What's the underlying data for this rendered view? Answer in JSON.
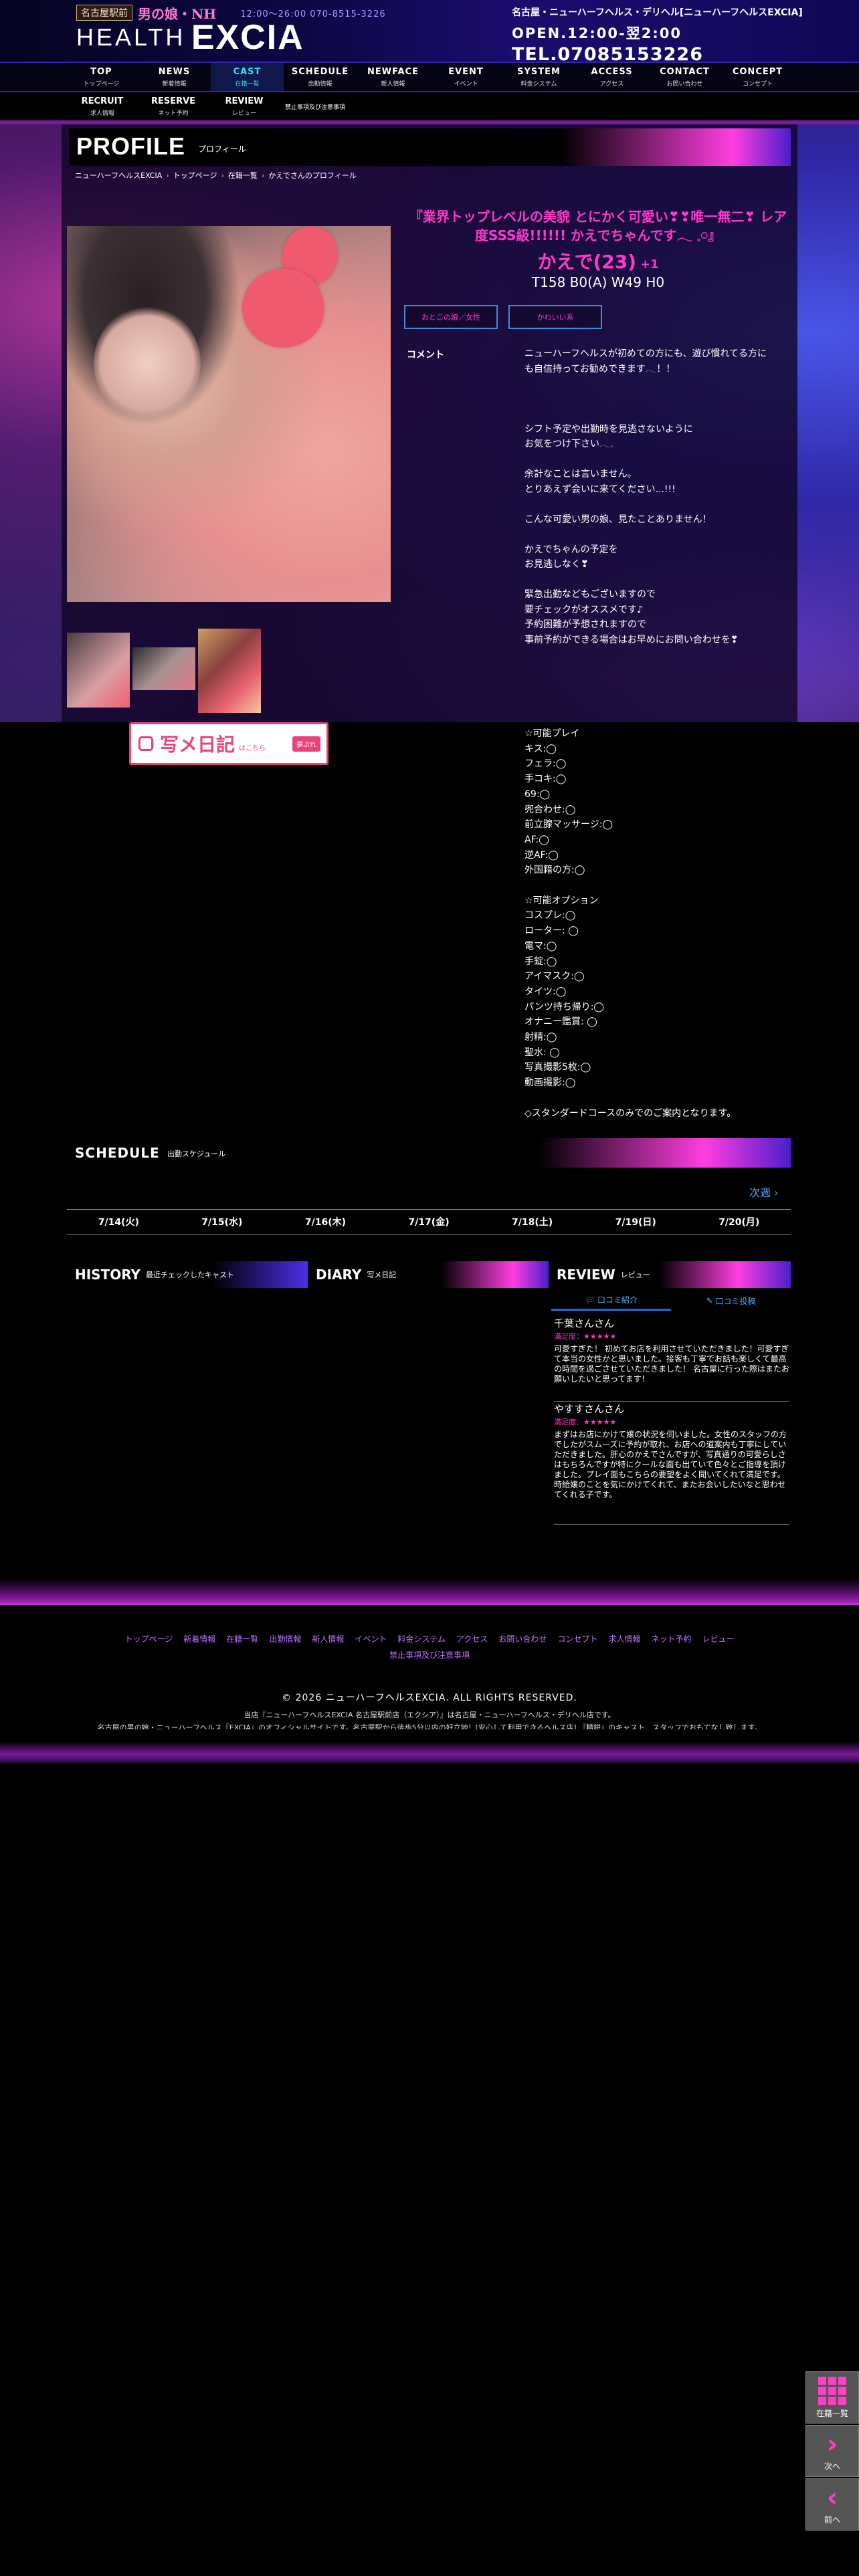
{
  "header": {
    "badge_area": "名古屋駅前",
    "badge_pink": "男の娘・NH",
    "hours_small": "12:00～26:00  070-8515-3226",
    "logo_line1": "HEALTH",
    "logo_line2": "EXCIA",
    "description": "名古屋・ニューハーフヘルス・デリヘル[ニューハーフヘルスEXCIA]",
    "open": "OPEN.12:00-翌2:00",
    "tel": "TEL.07085153226"
  },
  "nav": [
    {
      "en": "TOP",
      "ja": "トップページ"
    },
    {
      "en": "NEWS",
      "ja": "新着情報"
    },
    {
      "en": "CAST",
      "ja": "在籍一覧"
    },
    {
      "en": "SCHEDULE",
      "ja": "出勤情報"
    },
    {
      "en": "NEWFACE",
      "ja": "新人情報"
    },
    {
      "en": "EVENT",
      "ja": "イベント"
    },
    {
      "en": "SYSTEM",
      "ja": "料金システム"
    },
    {
      "en": "ACCESS",
      "ja": "アクセス"
    },
    {
      "en": "CONTACT",
      "ja": "お問い合わせ"
    },
    {
      "en": "CONCEPT",
      "ja": "コンセプト"
    }
  ],
  "subnav": [
    {
      "en": "RECRUIT",
      "ja": "求人情報"
    },
    {
      "en": "RESERVE",
      "ja": "ネット予約"
    },
    {
      "en": "REVIEW",
      "ja": "レビュー"
    },
    {
      "en": "禁止事項及び注意事項",
      "ja": ""
    }
  ],
  "profile": {
    "title": "PROFILE",
    "subtitle": "プロフィール",
    "breadcrumb": [
      "ニューハーフヘルスEXCIA",
      "トップページ",
      "在籍一覧",
      "かえでさんのプロフィール"
    ],
    "catch": "『業界トップレベルの美貌 とにかく可愛い❣❣唯一無二❣ レア度SSS級!!!!!! かえでちゃんです𓂃 𓈒𓏸』",
    "name": "かえで(23)",
    "new_mark": "+1",
    "measurements": "T158 B0(A) W49 H0",
    "tags": [
      "おとこの娘／女性",
      "かわいい系"
    ],
    "comment_label": "コメント",
    "comment": "ニューハーフヘルスが初めての方にも、遊び慣れてる方にも自信持ってお勧めできます𓂃！！\n\n\n\nシフト予定や出勤時を見逃さないように\nお気をつけ下さい𓂃𓈒\n\n余計なことは言いません。\nとりあえず会いに来てください...!!!\n\nこんな可愛い男の娘、見たことありません！\n\nかえでちゃんの予定を\nお見逃しなく❣\n\n緊急出勤などもございますので\n要チェックがオススメです♪\n予約困難が予想されますので\n事前予約ができる場合はお早めにお問い合わせを❣",
    "play_list": "☆可能プレイ\nキス:◯\nフェラ:◯\n手コキ:◯\n69:◯\n兜合わせ:◯\n前立腺マッサージ:◯\nAF:◯\n逆AF:◯\n外国籍の方:◯\n\n☆可能オプション\nコスプレ:◯\nローター: ◯\n電マ:◯\n手錠:◯\nアイマスク:◯\nタイツ:◯\nパンツ持ち帰り:◯\nオナニー鑑賞: ◯\n射精:◯\n聖水: ◯\n写真撮影5枚:◯\n動画撮影:◯\n\n◇スタンダードコースのみでのご案内となります。",
    "diary_banner": {
      "text": "写メ日記",
      "small": "はこちら",
      "pill": "夢ぷれ"
    }
  },
  "schedule": {
    "title": "SCHEDULE",
    "subtitle": "出勤スケジュール",
    "next_label": "次週",
    "days": [
      "7/14(火)",
      "7/15(水)",
      "7/16(木)",
      "7/17(金)",
      "7/18(土)",
      "7/19(日)",
      "7/20(月)"
    ]
  },
  "history": {
    "title": "HISTORY",
    "subtitle": "最近チェックしたキャスト"
  },
  "diary": {
    "title": "DIARY",
    "subtitle": "写メ日記"
  },
  "review": {
    "title": "REVIEW",
    "subtitle": "レビュー",
    "tabs": [
      "口コミ紹介",
      "口コミ投稿"
    ],
    "items": [
      {
        "name": "千葉さんさん",
        "level": "満足度：★★★★★",
        "text": "可愛すぎた！ 初めてお店を利用させていただきました！可愛すぎて本当の女性かと思いました。接客も丁寧でお話も楽しくて最高の時間を過ごさせていただきました！ 名古屋に行った際はまたお願いしたいと思ってます！"
      },
      {
        "name": "やすすさんさん",
        "level": "満足度：★★★★★",
        "text": "まずはお店にかけて嬢の状況を伺いました。女性のスタッフの方でしたがスムーズに予約が取れ、お店への道案内も丁寧にしていただきました。肝心のかえでさんですが、写真通りの可愛らしさはもちろんですが特にクールな面も出ていて色々とご指導を頂けました。プレイ面もこちらの要望をよく聞いてくれて満足です。時給嬢のことを気にかけてくれて、またお会いしたいなと思わせてくれる子です。"
      }
    ]
  },
  "footer": {
    "links": [
      "トップページ",
      "新着情報",
      "在籍一覧",
      "出勤情報",
      "新人情報",
      "イベント",
      "料金システム",
      "アクセス",
      "お問い合わせ",
      "コンセプト",
      "求人情報",
      "ネット予約",
      "レビュー"
    ],
    "link2": "禁止事項及び注意事項",
    "copyright": "© 2026 ニューハーフヘルスEXCIA. ALL RIGHTS RESERVED.",
    "desc1": "当店『ニューハーフヘルスEXCIA 名古屋駅前店（エクシア）』は名古屋・ニューハーフヘルス・デリヘル店です。",
    "desc2": "名古屋の男の娘・ニューハーフヘルス『EXCIA』のオフィシャルサイトです。名古屋駅から徒歩5分以内の好立地！[安心して利用できるヘルス店] 『精鋭』のキャスト、スタッフでおもてなし致します。"
  },
  "floating": {
    "list": "在籍一覧",
    "next": "次へ",
    "prev": "前へ"
  },
  "colors": {
    "accent_pink": "#ff38c8",
    "nav_active": "#3bd4ff",
    "link_blue": "#4fa8ff"
  }
}
